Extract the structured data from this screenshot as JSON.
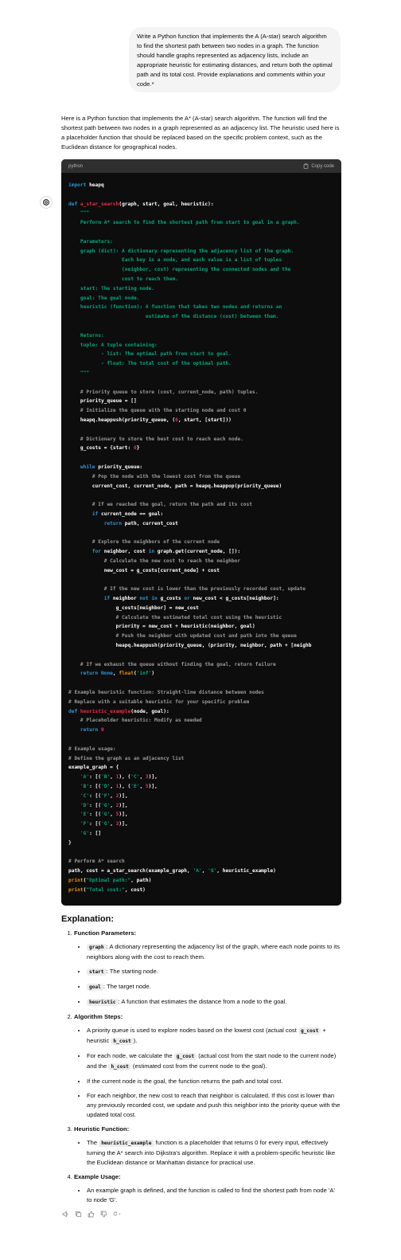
{
  "user": {
    "message": "Write a Python function that implements the A (A-star) search algorithm to find the shortest path between two nodes in a graph. The function should handle graphs represented as adjacency lists, include an appropriate heuristic for estimating distances, and return both the optimal path and its total cost. Provide explanations and comments within your code.*"
  },
  "assistant": {
    "intro": "Here is a Python function that implements the A* (A-star) search algorithm. The function will find the shortest path between two nodes in a graph represented as an adjacency list. The heuristic used here is a placeholder function that should be replaced based on the specific problem context, such as the Euclidean distance for geographical nodes.",
    "code_lang": "python",
    "copy_label": "Copy code",
    "explanation_title": "Explanation:",
    "sections": [
      {
        "title": "Function Parameters:",
        "points": [
          {
            "code": "graph",
            "text": ": A dictionary representing the adjacency list of the graph, where each node points to its neighbors along with the cost to reach them."
          },
          {
            "code": "start",
            "text": ": The starting node."
          },
          {
            "code": "goal",
            "text": ": The target node."
          },
          {
            "code": "heuristic",
            "text": ": A function that estimates the distance from a node to the goal."
          }
        ]
      },
      {
        "title": "Algorithm Steps:",
        "points": [
          {
            "before": "A priority queue is used to explore nodes based on the lowest cost (actual cost ",
            "code1": "g_cost",
            "mid": " + heuristic ",
            "code2": "h_cost",
            "after": ")."
          },
          {
            "before": "For each node, we calculate the ",
            "code1": "g_cost",
            "mid": " (actual cost from the start node to the current node) and the ",
            "code2": "h_cost",
            "after": " (estimated cost from the current node to the goal)."
          },
          {
            "text": "If the current node is the goal, the function returns the path and total cost."
          },
          {
            "text": "For each neighbor, the new cost to reach that neighbor is calculated. If this cost is lower than any previously recorded cost, we update and push this neighbor into the priority queue with the updated total cost."
          }
        ]
      },
      {
        "title": "Heuristic Function:",
        "points": [
          {
            "before": "The ",
            "code": "heuristic_example",
            "after": " function is a placeholder that returns 0 for every input, effectively turning the A* search into Dijkstra's algorithm. Replace it with a problem-specific heuristic like the Euclidean distance or Manhattan distance for practical use."
          }
        ]
      },
      {
        "title": "Example Usage:",
        "points": [
          {
            "text": "An example graph is defined, and the function is called to find the shortest path from node 'A' to node 'G'."
          }
        ]
      }
    ],
    "action_icons": [
      "speaker-icon",
      "copy-icon",
      "thumbs-up-icon",
      "thumbs-down-icon",
      "regenerate-icon"
    ]
  },
  "colors": {
    "code_bg": "#0d0d0d",
    "code_header_bg": "#2f2f2f",
    "keyword": "#2e95d3",
    "function_name": "#f22c3d",
    "string": "#00a67d",
    "comment": "#9a9a9a",
    "number": "#df3079",
    "builtin": "#e9950c"
  }
}
